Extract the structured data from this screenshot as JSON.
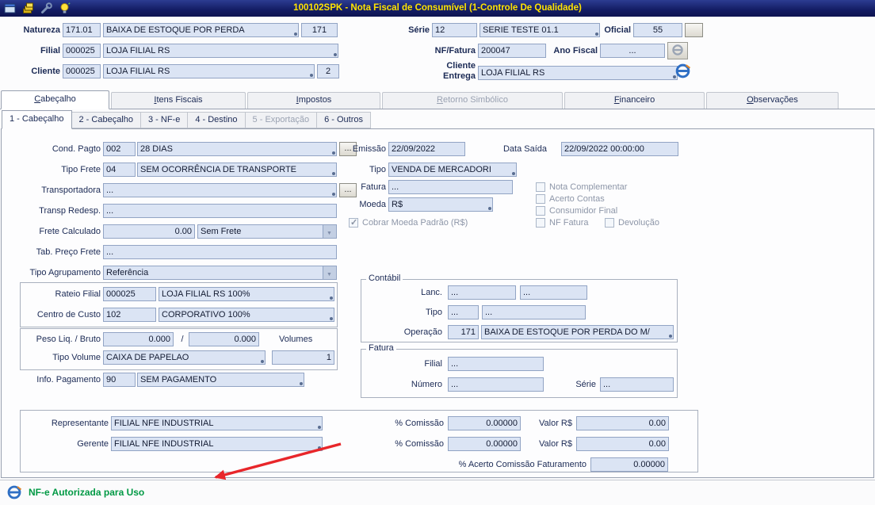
{
  "titlebar": {
    "title": "100102SPK - Nota Fiscal de Consumível (1-Controle De Qualidade)"
  },
  "icons": {
    "titlebar_icons": [
      "form-icon",
      "layers-icon",
      "wrench-icon",
      "bulb-icon"
    ],
    "nfe_logo_icon": "blue-e-swirl",
    "dropdown_arrow_icon": "▼",
    "checkmark_icon": "✓"
  },
  "header": {
    "natureza_label": "Natureza",
    "natureza_code": "171.01",
    "natureza_desc": "BAIXA DE ESTOQUE POR PERDA",
    "natureza_num": "171",
    "serie_label": "Série",
    "serie_code": "12",
    "serie_desc": "SERIE TESTE 01.1",
    "oficial_label": "Oficial",
    "oficial_value": "55",
    "filial_label": "Filial",
    "filial_code": "000025",
    "filial_desc": "LOJA FILIAL RS",
    "nf_fatura_label": "NF/Fatura",
    "nf_fatura_value": "200047",
    "ano_fiscal_label": "Ano Fiscal",
    "ano_fiscal_value": "...",
    "cliente_label": "Cliente",
    "cliente_code": "000025",
    "cliente_desc": "LOJA FILIAL RS",
    "cliente_num": "2",
    "cliente_entrega_label": "Cliente\nEntrega",
    "cliente_entrega_value": "LOJA FILIAL RS"
  },
  "tabs": [
    {
      "label": "Cabeçalho",
      "state": "active"
    },
    {
      "label": "Itens Fiscais",
      "state": "normal"
    },
    {
      "label": "Impostos",
      "state": "normal"
    },
    {
      "label": "Retorno Simbólico",
      "state": "disabled"
    },
    {
      "label": "Financeiro",
      "state": "normal"
    },
    {
      "label": "Observações",
      "state": "normal"
    }
  ],
  "subtabs": [
    {
      "label": "1 - Cabeçalho",
      "state": "active"
    },
    {
      "label": "2 - Cabeçalho",
      "state": "normal"
    },
    {
      "label": "3 - NF-e",
      "state": "normal"
    },
    {
      "label": "4 - Destino",
      "state": "normal"
    },
    {
      "label": "5 - Exportação",
      "state": "disabled"
    },
    {
      "label": "6 - Outros",
      "state": "normal"
    }
  ],
  "form": {
    "browse_button": "...",
    "cond_pagto_label": "Cond. Pagto",
    "cond_pagto_code": "002",
    "cond_pagto_desc": "28 DIAS",
    "tipo_frete_label": "Tipo Frete",
    "tipo_frete_code": "04",
    "tipo_frete_desc": "SEM OCORRÊNCIA DE TRANSPORTE",
    "transportadora_label": "Transportadora",
    "transportadora_value": "...",
    "transp_redesp_label": "Transp Redesp.",
    "transp_redesp_value": "...",
    "frete_calculado_label": "Frete Calculado",
    "frete_calculado_value": "0.00",
    "frete_tipo_value": "Sem Frete",
    "tab_preco_frete_label": "Tab. Preço Frete",
    "tab_preco_frete_value": "...",
    "tipo_agrupamento_label": "Tipo Agrupamento",
    "tipo_agrupamento_value": "Referência",
    "rateio_filial_label": "Rateio Filial",
    "rateio_filial_code": "000025",
    "rateio_filial_desc": "LOJA FILIAL RS 100%",
    "centro_custo_label": "Centro de Custo",
    "centro_custo_code": "102",
    "centro_custo_desc": "CORPORATIVO 100%",
    "peso_label": "Peso Liq. / Bruto",
    "peso_liq": "0.000",
    "peso_sep": "/",
    "peso_bruto": "0.000",
    "volumes_label": "Volumes",
    "tipo_volume_label": "Tipo Volume",
    "tipo_volume_value": "CAIXA DE PAPELAO",
    "volumes_qty": "1",
    "info_pagamento_label": "Info. Pagamento",
    "info_pagamento_code": "90",
    "info_pagamento_desc": "SEM PAGAMENTO",
    "emissao_label": "Emissão",
    "emissao_value": "22/09/2022",
    "data_saida_label": "Data Saída",
    "data_saida_value": "22/09/2022 00:00:00",
    "tipo_label": "Tipo",
    "tipo_value": "VENDA DE MERCADORI",
    "fatura_label": "Fatura",
    "fatura_value": "...",
    "moeda_label": "Moeda",
    "moeda_value": "R$",
    "checkboxes": {
      "cobrar_moeda": {
        "label": "Cobrar Moeda Padrão (R$)",
        "checked": true
      },
      "nota_complementar": {
        "label": "Nota Complementar",
        "checked": false
      },
      "acerto_contas": {
        "label": "Acerto Contas",
        "checked": false
      },
      "consumidor_final": {
        "label": "Consumidor Final",
        "checked": false
      },
      "nf_fatura": {
        "label": "NF Fatura",
        "checked": false
      },
      "devolucao": {
        "label": "Devolução",
        "checked": false
      }
    },
    "contabil": {
      "title": "Contábil",
      "lanc_label": "Lanc.",
      "lanc_v1": "...",
      "lanc_v2": "...",
      "tipo_label": "Tipo",
      "tipo_v1": "...",
      "tipo_v2": "...",
      "operacao_label": "Operação",
      "operacao_code": "171",
      "operacao_desc": "BAIXA DE ESTOQUE POR PERDA DO M/"
    },
    "fatura_group": {
      "title": "Fatura",
      "filial_label": "Filial",
      "filial_value": "...",
      "numero_label": "Número",
      "numero_value": "...",
      "serie_label": "Série",
      "serie_value": "..."
    },
    "comissao": {
      "representante_label": "Representante",
      "representante_value": "FILIAL NFE INDUSTRIAL",
      "rep_comissao_label": "% Comissão",
      "rep_comissao_value": "0.00000",
      "rep_valor_label": "Valor R$",
      "rep_valor_value": "0.00",
      "gerente_label": "Gerente",
      "gerente_value": "FILIAL NFE INDUSTRIAL",
      "ger_comissao_label": "% Comissão",
      "ger_comissao_value": "0.00000",
      "ger_valor_label": "Valor R$",
      "ger_valor_value": "0.00",
      "acerto_label": "% Acerto Comissão Faturamento",
      "acerto_value": "0.00000"
    }
  },
  "statusbar": {
    "message": "NF-e Autorizada para Uso"
  },
  "colors": {
    "titlebar": "#131c63",
    "title_text": "#ffe400",
    "field_bg": "#dbe4f4",
    "label_text": "#1b2a55",
    "status_green": "#009944",
    "arrow_red": "#e8262a"
  }
}
